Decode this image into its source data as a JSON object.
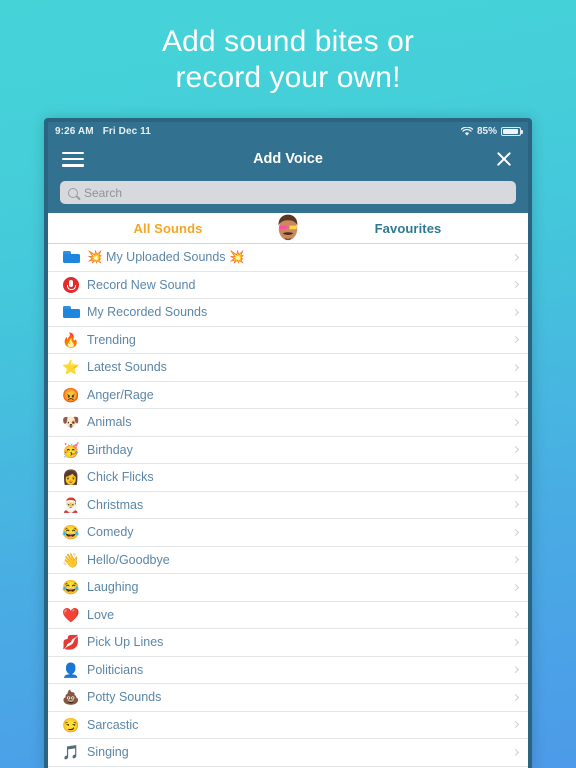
{
  "headline": {
    "line1": "Add sound bites or",
    "line2": "record your own!"
  },
  "colors": {
    "bg_top": "#45d3d8",
    "bg_bottom": "#4c9ae9",
    "navbar": "#32718f",
    "tab_active": "#f5a623",
    "tab_inactive": "#2e7a96",
    "list_text": "#5b86a8",
    "record_red": "#e32b2b",
    "folder_blue": "#1f86e0"
  },
  "status_bar": {
    "time": "9:26 AM",
    "date": "Fri Dec 11",
    "wifi_icon": "wifi-icon",
    "battery_percent": "85%",
    "battery_icon": "battery-icon"
  },
  "navbar": {
    "menu_icon": "hamburger-menu-icon",
    "title": "Add Voice",
    "close_icon": "close-icon"
  },
  "search": {
    "placeholder": "Search",
    "value": "",
    "icon": "search-icon"
  },
  "tabs": {
    "avatar_icon": "user-avatar",
    "items": [
      {
        "label": "All Sounds",
        "active": true
      },
      {
        "label": "Favourites",
        "active": false
      }
    ]
  },
  "list": {
    "chevron_icon": "chevron-right-icon",
    "items": [
      {
        "label": "💥 My Uploaded Sounds 💥",
        "icon": "folder-icon",
        "emoji": ""
      },
      {
        "label": "Record New Sound",
        "icon": "microphone-icon",
        "emoji": ""
      },
      {
        "label": "My Recorded Sounds",
        "icon": "folder-icon",
        "emoji": ""
      },
      {
        "label": "Trending",
        "icon": "fire-emoji",
        "emoji": "🔥"
      },
      {
        "label": "Latest Sounds",
        "icon": "star-emoji",
        "emoji": "⭐"
      },
      {
        "label": "Anger/Rage",
        "icon": "angry-face-emoji",
        "emoji": "😡"
      },
      {
        "label": "Animals",
        "icon": "dog-face-emoji",
        "emoji": "🐶"
      },
      {
        "label": "Birthday",
        "icon": "party-face-emoji",
        "emoji": "🥳"
      },
      {
        "label": "Chick Flicks",
        "icon": "woman-emoji",
        "emoji": "👩"
      },
      {
        "label": "Christmas",
        "icon": "santa-emoji",
        "emoji": "🎅"
      },
      {
        "label": "Comedy",
        "icon": "joy-face-emoji",
        "emoji": "😂"
      },
      {
        "label": "Hello/Goodbye",
        "icon": "waving-hand-emoji",
        "emoji": "👋"
      },
      {
        "label": "Laughing",
        "icon": "joy-face-emoji",
        "emoji": "😂"
      },
      {
        "label": "Love",
        "icon": "heart-emoji",
        "emoji": "❤️"
      },
      {
        "label": "Pick Up Lines",
        "icon": "kiss-mark-emoji",
        "emoji": "💋"
      },
      {
        "label": "Politicians",
        "icon": "bust-silhouette-emoji",
        "emoji": "👤"
      },
      {
        "label": "Potty Sounds",
        "icon": "poop-emoji",
        "emoji": "💩"
      },
      {
        "label": "Sarcastic",
        "icon": "smirk-face-emoji",
        "emoji": "😏"
      },
      {
        "label": "Singing",
        "icon": "music-note-emoji",
        "emoji": "🎵"
      }
    ]
  }
}
